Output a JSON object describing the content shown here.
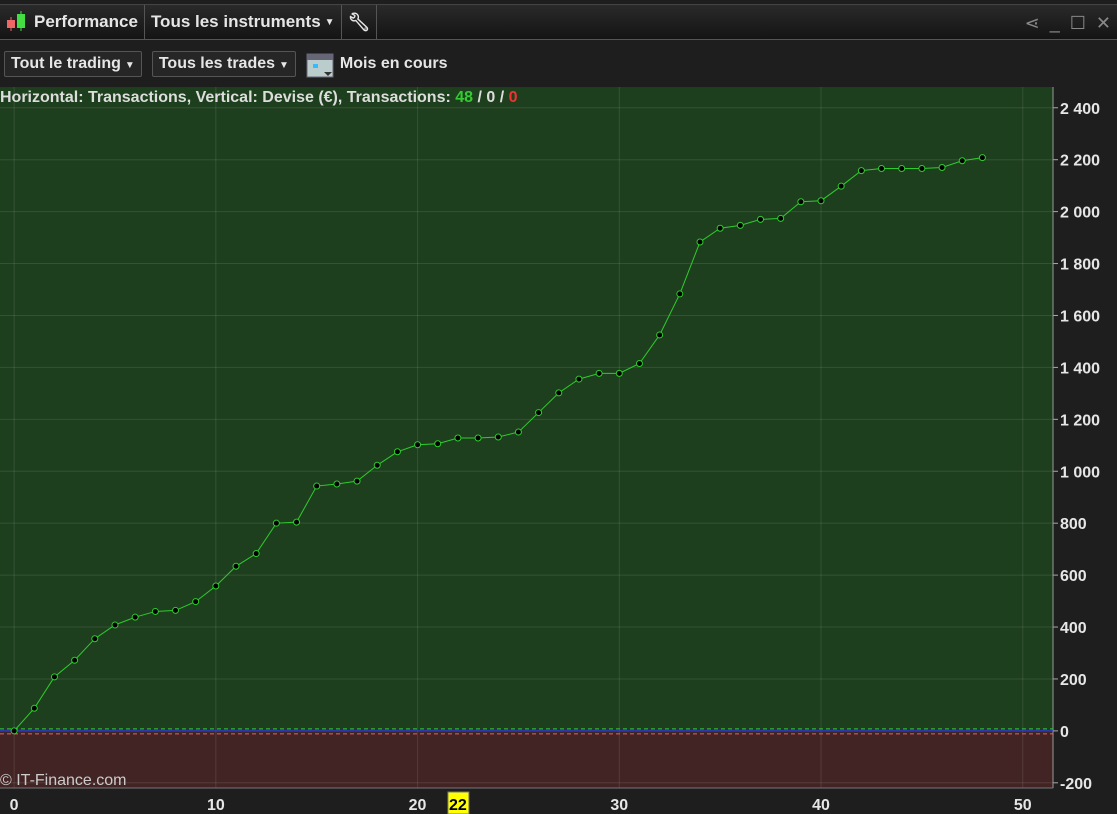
{
  "header": {
    "title": "Performance",
    "instruments": "Tous les instruments"
  },
  "toolbar": {
    "trading": "Tout le trading",
    "trades": "Tous les trades",
    "period": "Mois en cours"
  },
  "info": {
    "text": "Horizontal: Transactions, Vertical: Devise (€), Transactions: ",
    "count_win": "48",
    "sep1": " / ",
    "count_zero": "0",
    "sep2": " / ",
    "count_loss": "0"
  },
  "watermark": "© IT-Finance.com",
  "colors": {
    "positive_bg": "#1e3f1e",
    "negative_bg": "#432424",
    "line": "#2ecc2e",
    "highlight": "#ffff00"
  },
  "chart_data": {
    "type": "line",
    "xlabel": "Transactions",
    "ylabel": "Devise (€)",
    "xlim": [
      -0.7,
      51.5
    ],
    "ylim": [
      -220,
      2480
    ],
    "x_ticks": [
      0,
      10,
      20,
      30,
      40,
      50
    ],
    "y_ticks": [
      -200,
      0,
      200,
      400,
      600,
      800,
      1000,
      1200,
      1400,
      1600,
      1800,
      2000,
      2200,
      2400
    ],
    "y_tick_labels": [
      "-200",
      "0",
      "200",
      "400",
      "600",
      "800",
      "1 000",
      "1 200",
      "1 400",
      "1 600",
      "1 800",
      "2 000",
      "2 200",
      "2 400"
    ],
    "highlight_x": "22",
    "values": [
      0,
      87,
      208,
      272,
      355,
      408,
      438,
      460,
      464,
      498,
      558,
      634,
      683,
      800,
      804,
      943,
      951,
      962,
      1023,
      1075,
      1102,
      1106,
      1128,
      1128,
      1132,
      1151,
      1226,
      1302,
      1355,
      1377,
      1377,
      1415,
      1525,
      1683,
      1883,
      1936,
      1947,
      1970,
      1974,
      2038,
      2042,
      2098,
      2158,
      2166,
      2166,
      2166,
      2170,
      2196,
      2208
    ]
  }
}
